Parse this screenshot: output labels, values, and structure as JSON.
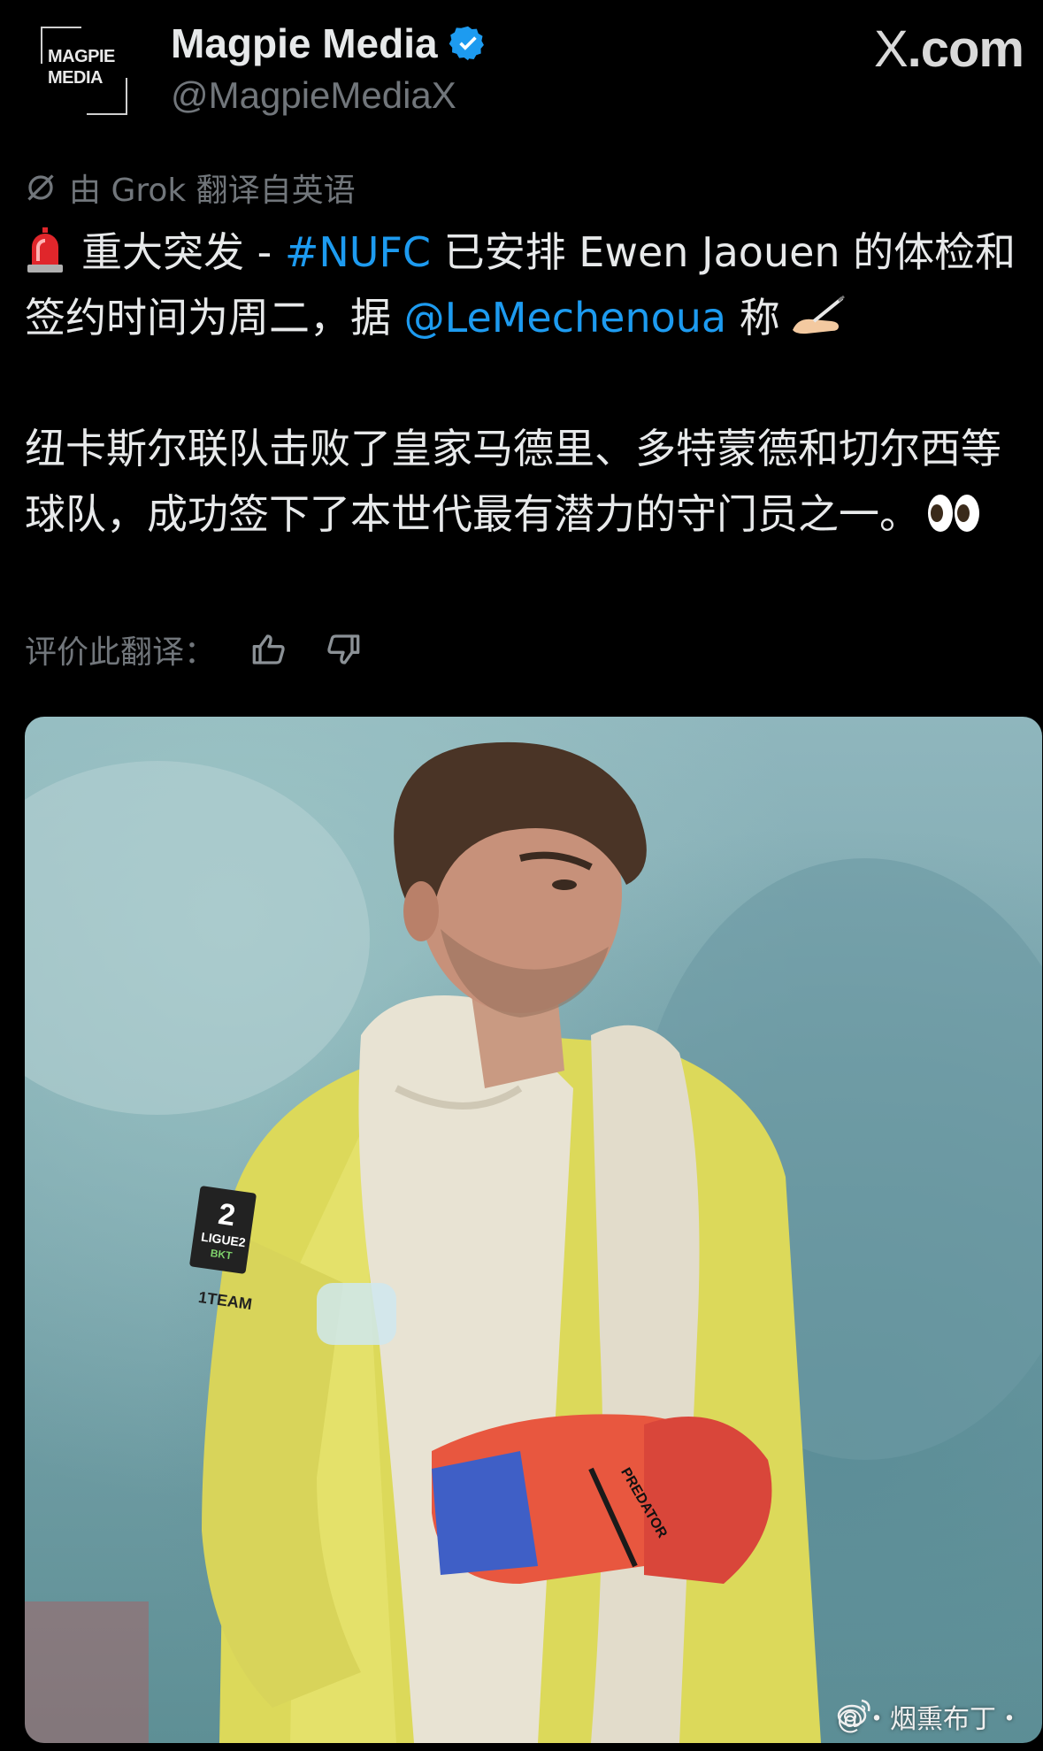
{
  "author": {
    "avatar_text_line1": "MAGPIE",
    "avatar_text_line2": "MEDIA",
    "name": "Magpie Media",
    "handle": "@MagpieMediaX",
    "verified_icon": "verified-badge-icon",
    "verified_color": "#1d9bf0"
  },
  "brand": {
    "x_mark": "X",
    "domain_suffix": ".com"
  },
  "translation": {
    "note": "由 Grok 翻译自英语",
    "icon": "grok-icon"
  },
  "tweet": {
    "line1_pre": "重大突发 - ",
    "hashtag": "#NUFC",
    "line1_post": " 已安排 Ewen Jaouen 的体检和签约时间为周二，据 ",
    "mention": "@LeMechenoua",
    "line1_end": " 称",
    "para2": "纽卡斯尔联队击败了皇家马德里、多特蒙德和切尔西等球队，成功签下了本世代最有潜力的守门员之一。",
    "emojis": [
      "siren-emoji",
      "writing-hand-emoji",
      "eyes-emoji"
    ],
    "link_color": "#1d9bf0"
  },
  "rating": {
    "label": "评价此翻译：",
    "thumbs_up_icon": "thumbs-up-icon",
    "thumbs_down_icon": "thumbs-down-icon"
  },
  "media": {
    "jersey_badge_line1": "2",
    "jersey_badge_line2": "LIGUE2",
    "jersey_badge_line3": "BKT",
    "jersey_text": "1TEAM",
    "glove_text": "PREDATOR"
  },
  "watermark": {
    "text": "@・烟熏布丁・",
    "icon": "weibo-icon"
  }
}
